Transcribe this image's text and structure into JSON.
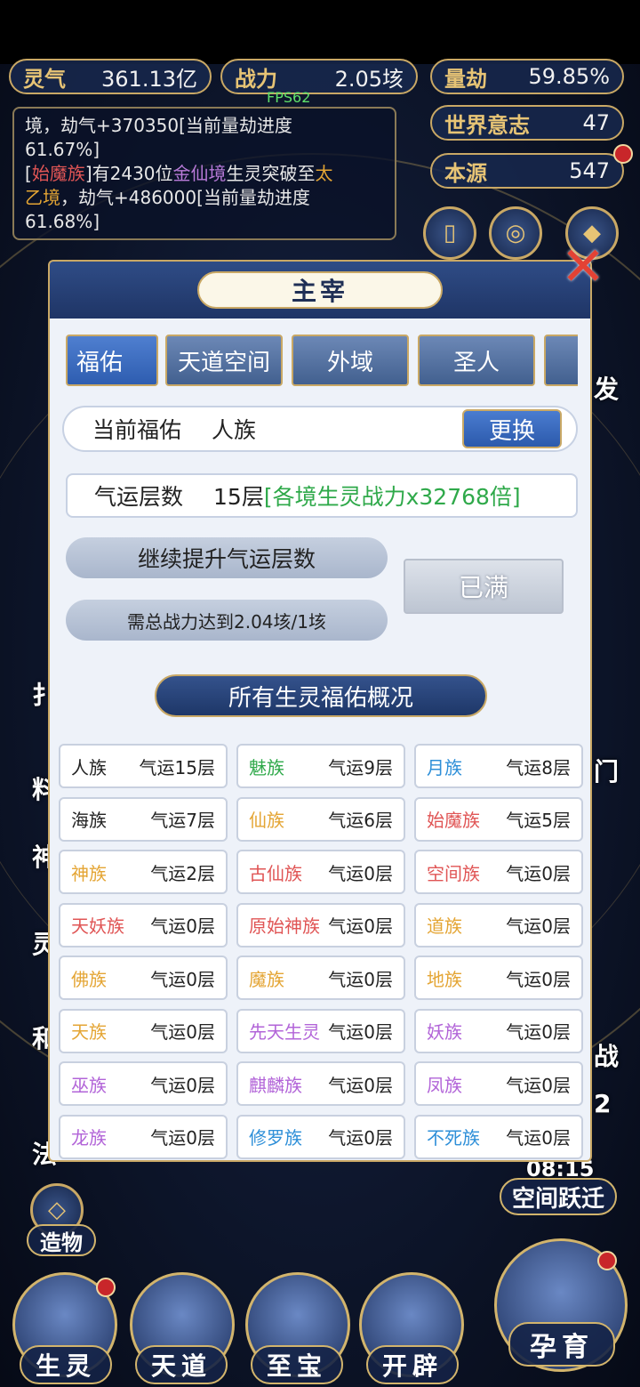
{
  "top_stats": {
    "lingqi": {
      "label": "灵气",
      "value": "361.13亿"
    },
    "zhanli": {
      "label": "战力",
      "value": "2.05垓"
    },
    "liangjie": {
      "label": "量劫",
      "value": "59.85%"
    },
    "shijie": {
      "label": "世界意志",
      "value": "47"
    },
    "benyuan": {
      "label": "本源",
      "value": "547"
    }
  },
  "fps": "FPS62",
  "log": {
    "l1a": "境，劫气+370350[当前量劫进度",
    "l1b": "61.67%]",
    "l2_bracket_open": "[",
    "l2_race": "始魔族",
    "l2_text1": "]有2430位",
    "l2_realm1": "金仙境",
    "l2_text2": "生灵突破至",
    "l2_realm2a": "太",
    "l2_realm2b": "乙境",
    "l2_text3": "，劫气+486000[当前量劫进度",
    "l2_end": "61.68%]"
  },
  "side": {
    "left_labels": [
      "扌",
      "料",
      "神",
      "灵",
      "和",
      "法"
    ],
    "right_labels": [
      "发",
      "门",
      "战",
      "2"
    ],
    "time": "08:15",
    "space_jump": "空间跃迁",
    "zaowu": "造物"
  },
  "bottom": {
    "shengling": "生灵",
    "tiandao": "天道",
    "zhibao": "至宝",
    "kaipi": "开辟",
    "yunyu": "孕育"
  },
  "panel": {
    "title": "主宰",
    "close": "✕",
    "tabs": [
      "福佑",
      "天道空间",
      "外域",
      "圣人",
      ""
    ],
    "current_label": "当前福佑",
    "current_value": "人族",
    "change_btn": "更换",
    "fortune_label": "气运层数",
    "fortune_value": "15层",
    "fortune_bonus": "[各境生灵战力x32768倍]",
    "upgrade_label": "继续提升气运层数",
    "requirement": "需总战力达到2.04垓/1垓",
    "full_btn": "已满",
    "section_title": "所有生灵福佑概况"
  },
  "races": [
    {
      "name": "人族",
      "level": "气运15层",
      "color": "#222222"
    },
    {
      "name": "魅族",
      "level": "气运9层",
      "color": "#2fa94a"
    },
    {
      "name": "月族",
      "level": "气运8层",
      "color": "#2e8fd8"
    },
    {
      "name": "海族",
      "level": "气运7层",
      "color": "#222222"
    },
    {
      "name": "仙族",
      "level": "气运6层",
      "color": "#e4a534"
    },
    {
      "name": "始魔族",
      "level": "气运5层",
      "color": "#e05555"
    },
    {
      "name": "神族",
      "level": "气运2层",
      "color": "#e4a534"
    },
    {
      "name": "古仙族",
      "level": "气运0层",
      "color": "#e05555"
    },
    {
      "name": "空间族",
      "level": "气运0层",
      "color": "#e05555"
    },
    {
      "name": "天妖族",
      "level": "气运0层",
      "color": "#e05555"
    },
    {
      "name": "原始神族",
      "level": "气运0层",
      "color": "#e05555"
    },
    {
      "name": "道族",
      "level": "气运0层",
      "color": "#e4a534"
    },
    {
      "name": "佛族",
      "level": "气运0层",
      "color": "#e4a534"
    },
    {
      "name": "魔族",
      "level": "气运0层",
      "color": "#e4a534"
    },
    {
      "name": "地族",
      "level": "气运0层",
      "color": "#e4a534"
    },
    {
      "name": "天族",
      "level": "气运0层",
      "color": "#e4a534"
    },
    {
      "name": "先天生灵",
      "level": "气运0层",
      "color": "#b264d8"
    },
    {
      "name": "妖族",
      "level": "气运0层",
      "color": "#b264d8"
    },
    {
      "name": "巫族",
      "level": "气运0层",
      "color": "#b264d8"
    },
    {
      "name": "麒麟族",
      "level": "气运0层",
      "color": "#b264d8"
    },
    {
      "name": "凤族",
      "level": "气运0层",
      "color": "#b264d8"
    },
    {
      "name": "龙族",
      "level": "气运0层",
      "color": "#b264d8"
    },
    {
      "name": "修罗族",
      "level": "气运0层",
      "color": "#2e8fd8"
    },
    {
      "name": "不死族",
      "level": "气运0层",
      "color": "#2e8fd8"
    }
  ]
}
